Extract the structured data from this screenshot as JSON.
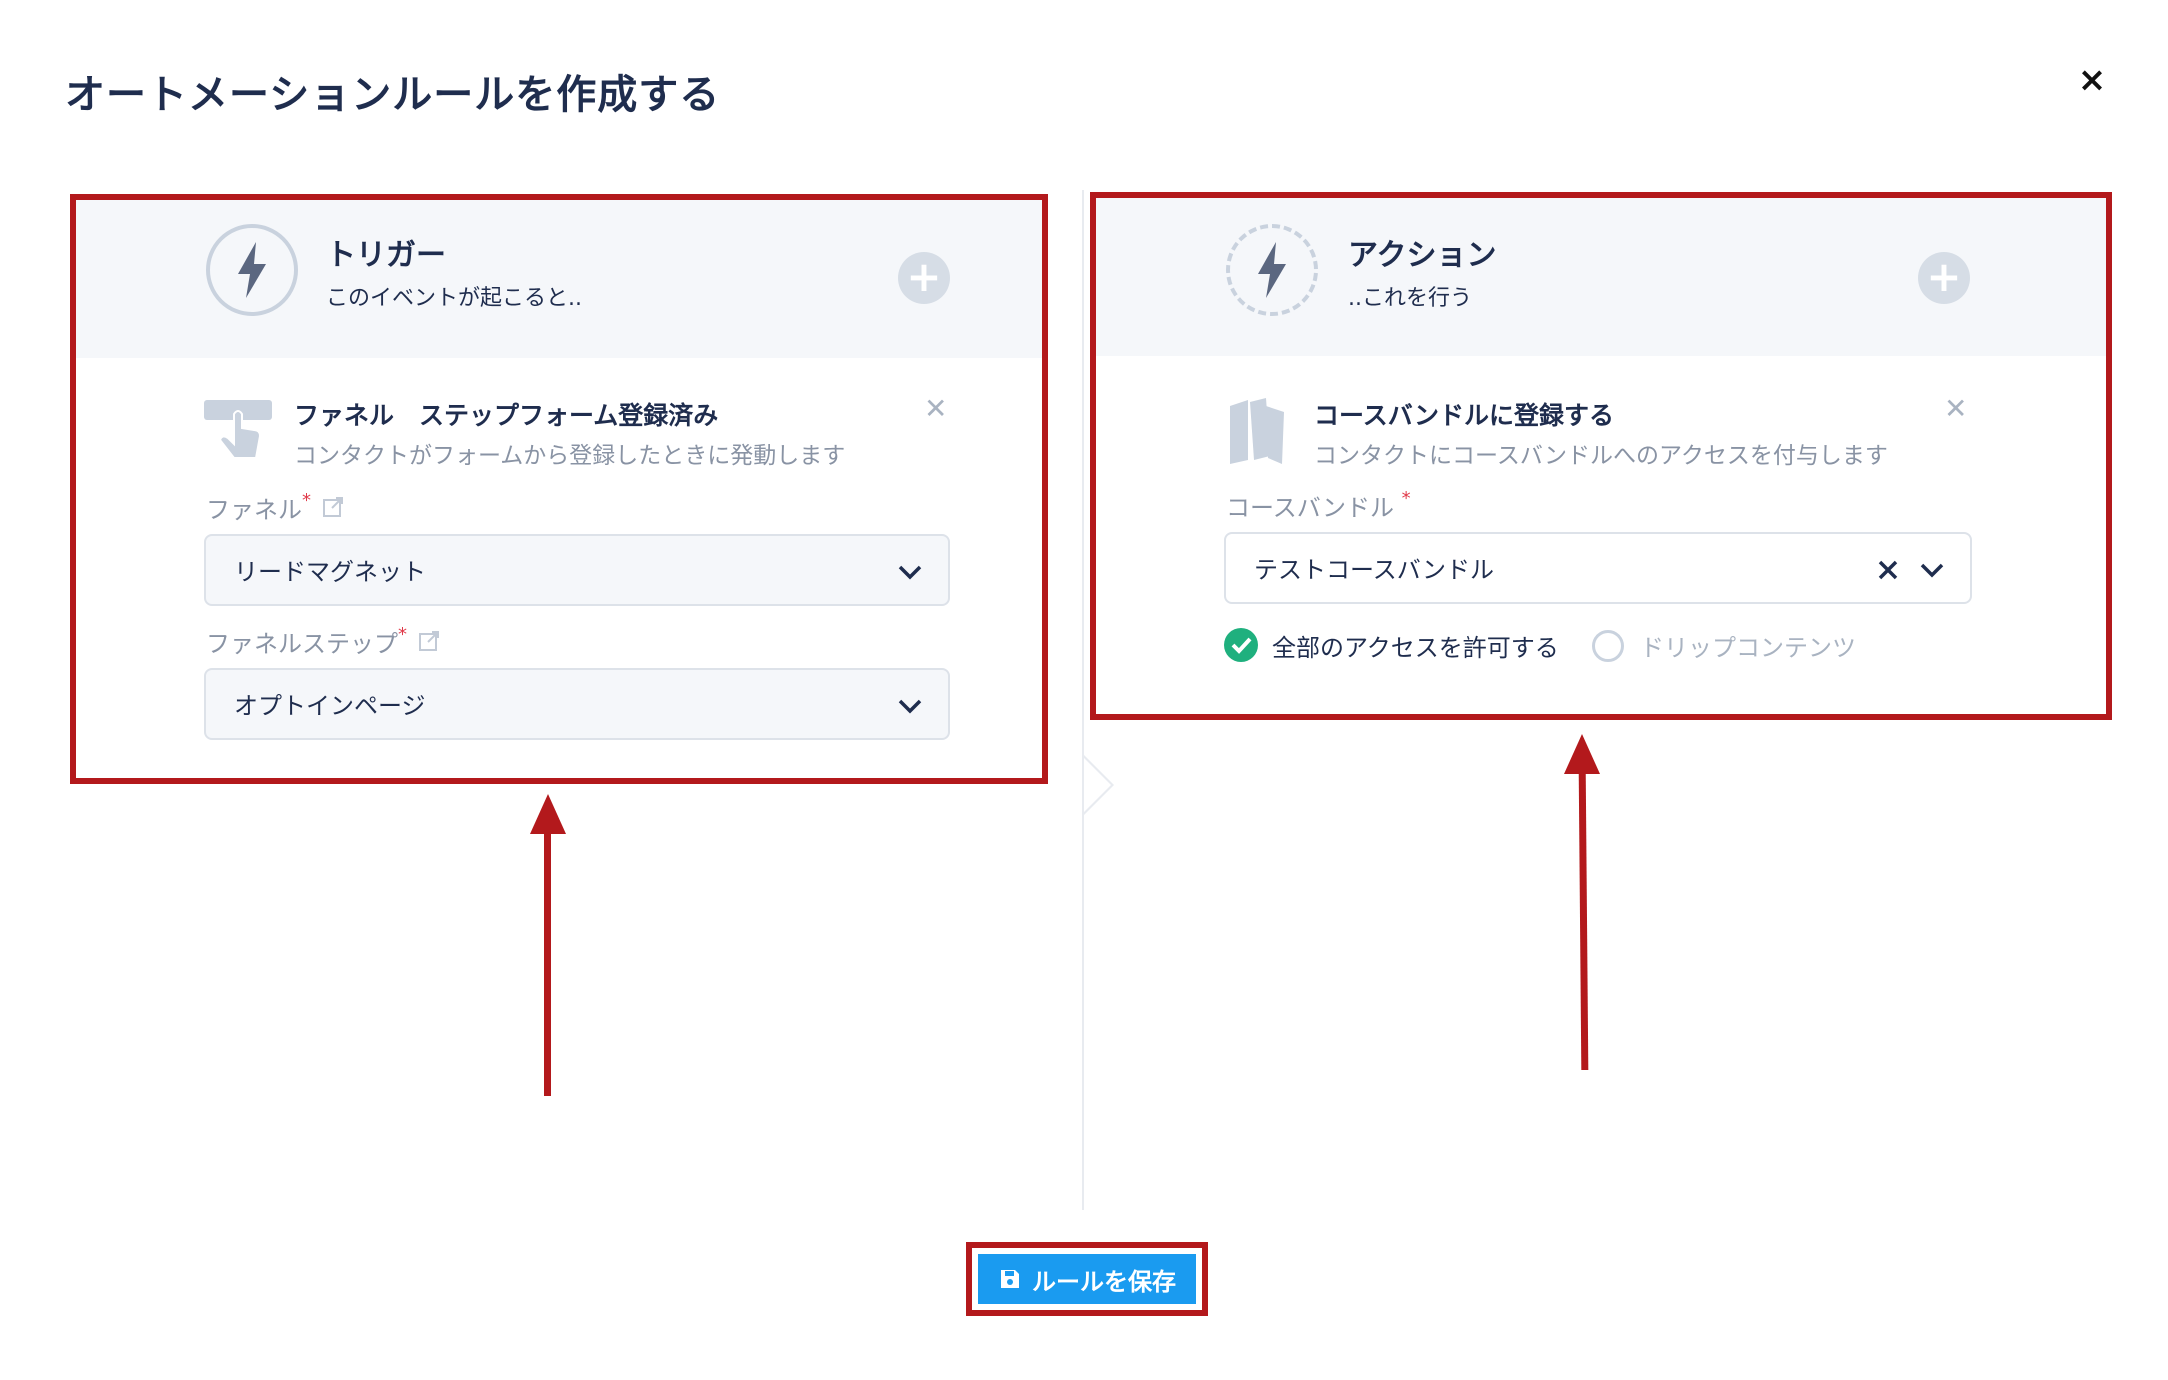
{
  "dialog": {
    "title": "オートメーションルールを作成する",
    "close_label": "×"
  },
  "trigger": {
    "header_title": "トリガー",
    "header_sub": "このイベントが起こると..",
    "item_title": "ファネル　ステップフォーム登録済み",
    "item_desc": "コンタクトがフォームから登録したときに発動します",
    "funnel_label": "ファネル",
    "funnel_value": "リードマグネット",
    "step_label": "ファネルステップ",
    "step_value": "オプトインページ",
    "required_mark": "*"
  },
  "action": {
    "header_title": "アクション",
    "header_sub": "..これを行う",
    "item_title": "コースバンドルに登録する",
    "item_desc": "コンタクトにコースバンドルへのアクセスを付与します",
    "bundle_label": "コースバンドル",
    "bundle_value": "テストコースバンドル",
    "required_mark": "*",
    "option_all": "全部のアクセスを許可する",
    "option_drip": "ドリップコンテンツ",
    "selected_option": "全部のアクセスを許可する"
  },
  "footer": {
    "save_label": "ルールを保存"
  },
  "colors": {
    "highlight": "#b3191c",
    "primary": "#1a9bf0",
    "success": "#1fb07e"
  }
}
